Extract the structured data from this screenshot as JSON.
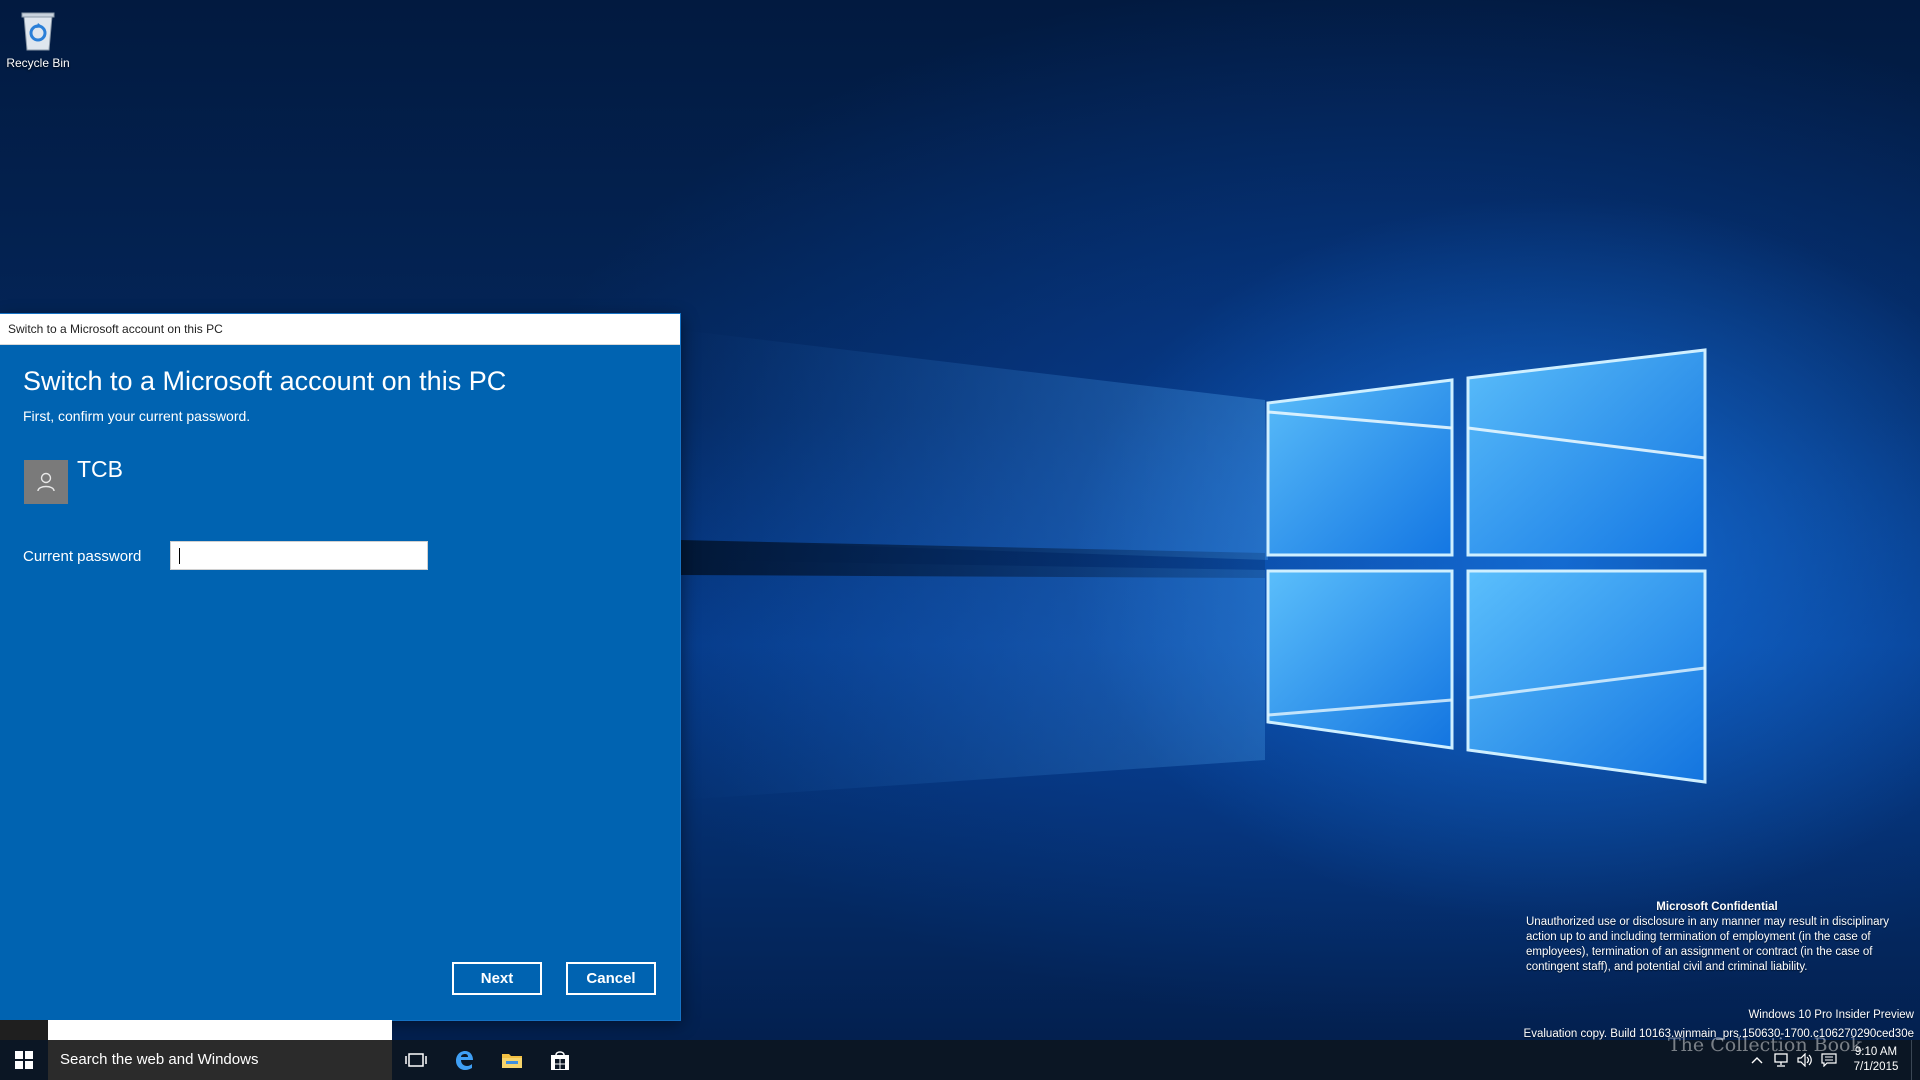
{
  "desktop": {
    "icons": [
      {
        "label": "Recycle Bin",
        "icon": "recycle-bin-icon"
      }
    ]
  },
  "dialog": {
    "window_title": "Switch to a Microsoft account on this PC",
    "heading": "Switch to a Microsoft account on this PC",
    "subheading": "First, confirm your current password.",
    "account_name": "TCB",
    "password_label": "Current password",
    "password_value": "",
    "next_label": "Next",
    "cancel_label": "Cancel",
    "colors": {
      "background": "#0063b1",
      "avatar": "#7a7a7a"
    }
  },
  "notice": {
    "title": "Microsoft Confidential",
    "body": "Unauthorized use or disclosure in any manner may result in disciplinary action up to and including termination of employment (in the case of employees), termination of an assignment or contract (in the case of contingent staff), and potential civil and criminal liability.",
    "edition": "Windows 10 Pro Insider Preview",
    "build": "Evaluation copy. Build 10163.winmain_prs.150630-1700.c106270290ced30e"
  },
  "taskbar": {
    "search_placeholder": "Search the web and Windows",
    "pinned": [
      "task-view-icon",
      "edge-icon",
      "file-explorer-icon",
      "store-icon"
    ],
    "clock_time": "9:10 AM",
    "clock_date": "7/1/2015"
  },
  "watermark": "The Collection Book"
}
